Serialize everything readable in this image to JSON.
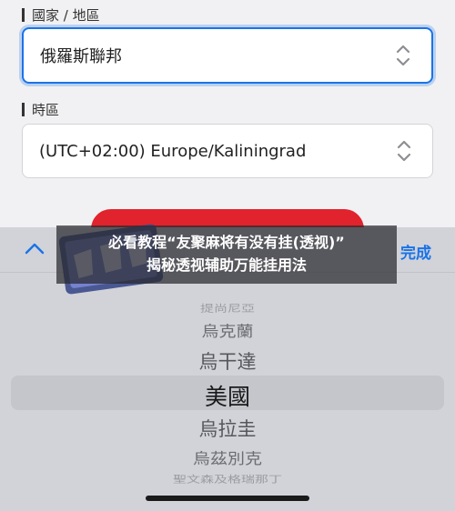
{
  "form": {
    "region_label": "國家 / 地區",
    "region_value": "俄羅斯聯邦",
    "timezone_label": "時區",
    "timezone_value": "(UTC+02:00) Europe/Kaliningrad"
  },
  "picker": {
    "done_label": "完成",
    "items": [
      "提尚尼亞",
      "烏克蘭",
      "烏干達",
      "美國",
      "烏拉圭",
      "烏茲別克",
      "聖文森及格瑞那丁"
    ],
    "selected_index": 3
  },
  "overlay": {
    "line1": "必看教程“友聚麻将有没有挂(透视)”",
    "line2": "揭秘透视辅助万能挂用法"
  },
  "colors": {
    "accent": "#1a73e8",
    "red_button": "#e0232d"
  }
}
